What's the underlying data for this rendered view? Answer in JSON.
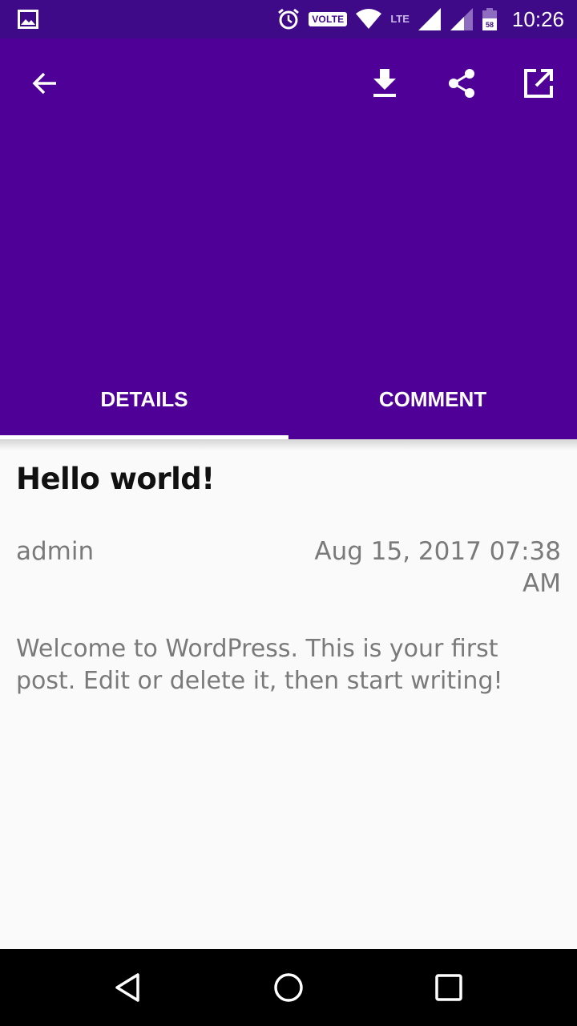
{
  "status_bar": {
    "time": "10:26",
    "volte": "VOLTE",
    "network": "LTE",
    "battery": "58",
    "icons": [
      "image-icon",
      "alarm-icon",
      "wifi-icon",
      "signal-icon",
      "signal-icon",
      "battery-icon"
    ]
  },
  "toolbar": {
    "back_icon": "arrow-back-icon",
    "download_icon": "download-icon",
    "share_icon": "share-icon",
    "open_icon": "open-external-icon"
  },
  "tabs": [
    {
      "label": "DETAILS",
      "active": true
    },
    {
      "label": "COMMENT",
      "active": false
    }
  ],
  "post": {
    "title": "Hello world!",
    "author": "admin",
    "date": "Aug 15, 2017 07:38 AM",
    "body": "Welcome to WordPress. This is your first post. Edit or delete it, then start writing!"
  },
  "nav_bar": {
    "icons": [
      "nav-back-icon",
      "nav-home-icon",
      "nav-recent-icon"
    ]
  },
  "colors": {
    "status_bar": "#3f0a88",
    "header": "#4e0097",
    "text_secondary": "#7a7a7a",
    "background": "#fafafa"
  }
}
